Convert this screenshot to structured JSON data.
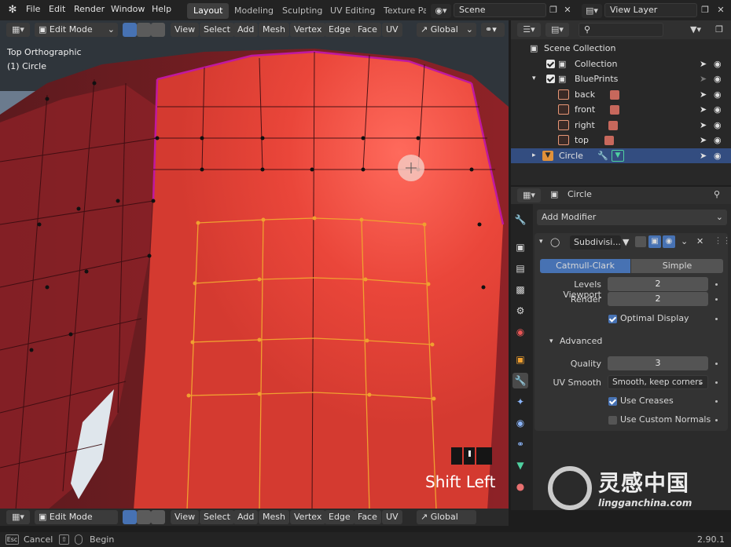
{
  "app": {
    "icon": "blender-logo-icon",
    "version": "2.90.1"
  },
  "menu": {
    "file": "File",
    "edit": "Edit",
    "render": "Render",
    "window": "Window",
    "help": "Help"
  },
  "workspaces": [
    "Layout",
    "Modeling",
    "Sculpting",
    "UV Editing",
    "Texture Pa"
  ],
  "scene": {
    "value": "Scene"
  },
  "view_layer": {
    "value": "View Layer"
  },
  "viewport": {
    "mode": "Edit Mode",
    "menus": [
      "View",
      "Select",
      "Add",
      "Mesh",
      "Vertex",
      "Edge",
      "Face",
      "UV"
    ],
    "transform_orientation": "Global",
    "overlay_title": "Top Orthographic",
    "overlay_object": "(1) Circle",
    "key_hint": "Shift Left",
    "colors": {
      "mesh": "#e8453a",
      "mesh_dark": "#7a1c22",
      "edge_selected": "#f0a030",
      "background": "#30363d"
    }
  },
  "outliner": {
    "search_placeholder": "",
    "root": "Scene Collection",
    "items": [
      {
        "label": "Collection",
        "checked": true
      },
      {
        "label": "BluePrints",
        "checked": true
      },
      {
        "label": "back"
      },
      {
        "label": "front"
      },
      {
        "label": "right"
      },
      {
        "label": "top"
      },
      {
        "label": "Circle",
        "selected": true
      }
    ]
  },
  "properties": {
    "object_name": "Circle",
    "add_modifier": "Add Modifier",
    "modifier_name": "Subdivisi...",
    "algorithms": [
      "Catmull-Clark",
      "Simple"
    ],
    "active_algorithm": "Catmull-Clark",
    "levels_viewport_label": "Levels Viewport",
    "levels_viewport": "2",
    "render_label": "Render",
    "render": "2",
    "optimal_display": "Optimal Display",
    "advanced": "Advanced",
    "quality_label": "Quality",
    "quality": "3",
    "uv_smooth_label": "UV Smooth",
    "uv_smooth": "Smooth, keep corners",
    "use_creases": "Use Creases",
    "use_custom_normals": "Use Custom Normals"
  },
  "statusbar": {
    "esc": "Esc",
    "cancel": "Cancel",
    "begin": "Begin"
  },
  "watermark": {
    "cn": "灵感中国",
    "url": "lingganchina.com"
  }
}
